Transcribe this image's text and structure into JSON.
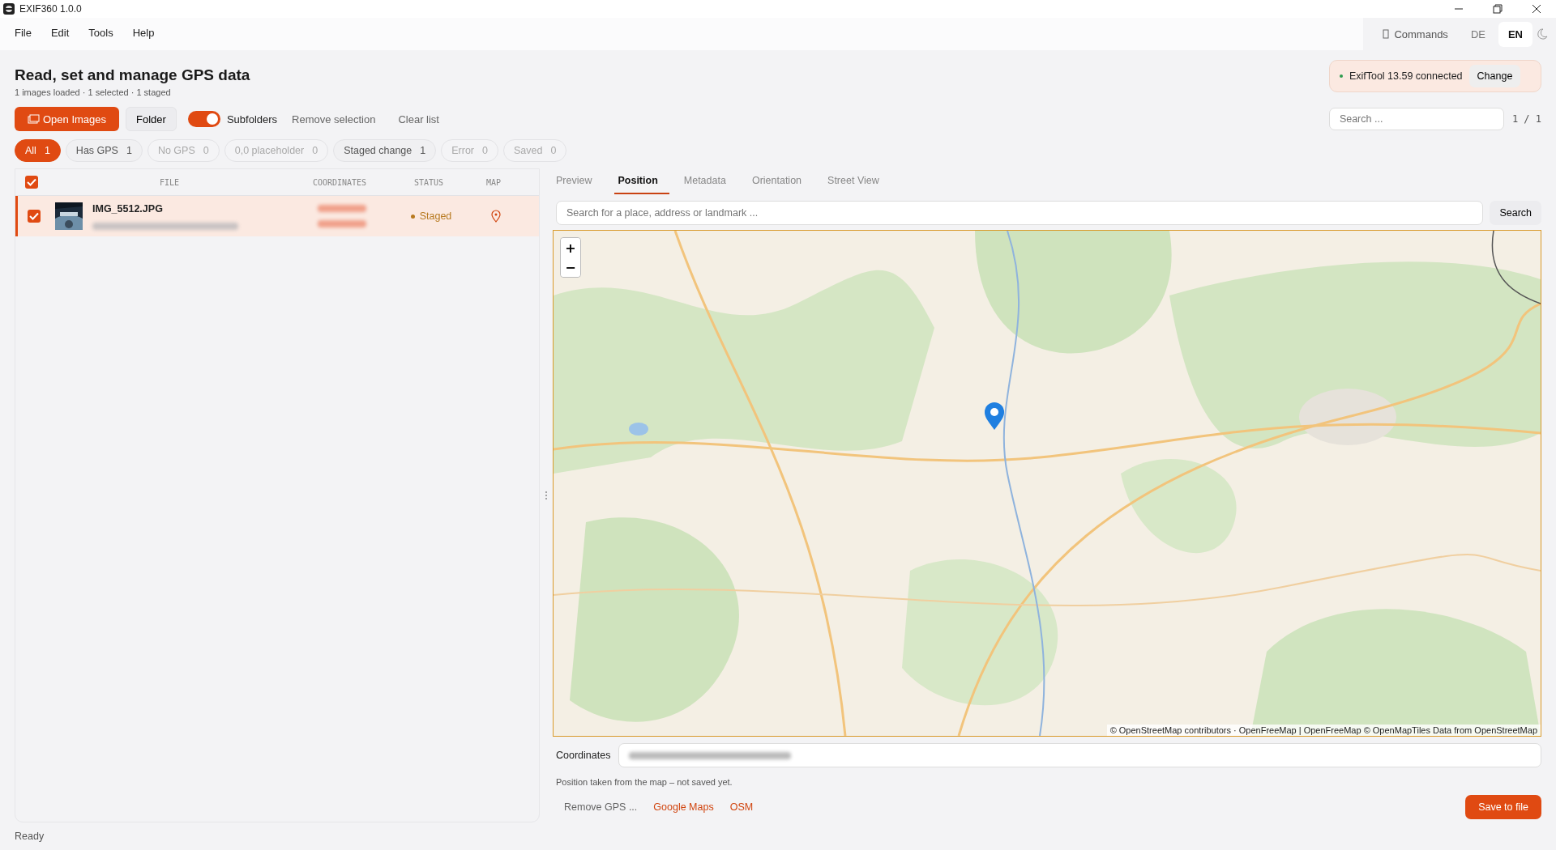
{
  "window": {
    "title": "EXIF360 1.0.0"
  },
  "menu": [
    "File",
    "Edit",
    "Tools",
    "Help"
  ],
  "commands": {
    "label": "Commands"
  },
  "languages": [
    {
      "label": "DE",
      "selected": false
    },
    {
      "label": "EN",
      "selected": true
    }
  ],
  "header": {
    "title": "Read, set and manage GPS data",
    "subtitle": "1 images loaded · 1 selected · 1 staged"
  },
  "exiftool": {
    "status": "ExifTool 13.59 connected",
    "connected": true,
    "button": "Change"
  },
  "toolbar": {
    "open_button": "Open Images",
    "folder_button": "Folder",
    "subfolders": {
      "label": "Subfolders",
      "on": true
    },
    "remove_selection": "Remove selection",
    "clear_list": "Clear list"
  },
  "search": {
    "placeholder": "Search ...",
    "pager": "1 / 1"
  },
  "filters": [
    {
      "label": "All",
      "count": "1",
      "selected": true,
      "disabled": false
    },
    {
      "label": "Has GPS",
      "count": "1",
      "selected": false,
      "disabled": false
    },
    {
      "label": "No GPS",
      "count": "0",
      "selected": false,
      "disabled": true
    },
    {
      "label": "0,0 placeholder",
      "count": "0",
      "selected": false,
      "disabled": true
    },
    {
      "label": "Staged change",
      "count": "1",
      "selected": false,
      "disabled": false
    },
    {
      "label": "Error",
      "count": "0",
      "selected": false,
      "disabled": true
    },
    {
      "label": "Saved",
      "count": "0",
      "selected": false,
      "disabled": true
    }
  ],
  "table": {
    "select_all": true,
    "columns": [
      "FILE",
      "COORDINATES",
      "STATUS",
      "MAP"
    ],
    "rows": [
      {
        "file": "IMG_5512.JPG",
        "status": "Staged",
        "checked": true,
        "selected": true
      }
    ]
  },
  "tabs": [
    {
      "label": "Preview",
      "selected": false
    },
    {
      "label": "Position",
      "selected": true
    },
    {
      "label": "Metadata",
      "selected": false
    },
    {
      "label": "Orientation",
      "selected": false
    },
    {
      "label": "Street View",
      "selected": false
    }
  ],
  "place_search": {
    "placeholder": "Search for a place, address or landmark ...",
    "button": "Search"
  },
  "map": {
    "kind": "picture",
    "zoom_in": "+",
    "zoom_out": "−",
    "attribution": "© OpenStreetMap contributors · OpenFreeMap | OpenFreeMap © OpenMapTiles Data from OpenStreetMap"
  },
  "coordinates": {
    "label": "Coordinates"
  },
  "note": "Position taken from the map – not saved yet.",
  "actions": [
    {
      "label": "Remove GPS ...",
      "kind": "muted"
    },
    {
      "label": "Google Maps",
      "kind": "link"
    },
    {
      "label": "OSM",
      "kind": "link"
    }
  ],
  "save_button": "Save to file",
  "status_bar": "Ready"
}
